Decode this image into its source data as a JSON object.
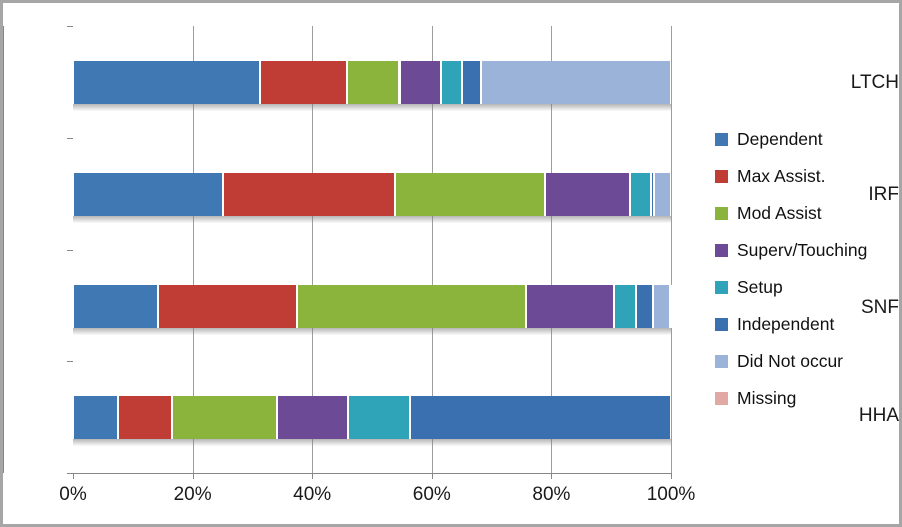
{
  "chart_data": {
    "type": "bar",
    "orientation": "horizontal",
    "stacked": true,
    "stack_mode": "percent",
    "title": "",
    "xlabel": "",
    "ylabel": "",
    "xlim": [
      0,
      100
    ],
    "x_tick_labels": [
      "0%",
      "20%",
      "40%",
      "60%",
      "80%",
      "100%"
    ],
    "x_ticks": [
      0,
      20,
      40,
      60,
      80,
      100
    ],
    "grid": true,
    "grid_axis": "x",
    "legend_position": "right",
    "categories": [
      "LTCH",
      "IRF",
      "SNF",
      "HHA"
    ],
    "series": [
      {
        "name": "Dependent",
        "color": "#4078b4",
        "values": [
          31.3,
          25.1,
          14.2,
          7.6
        ]
      },
      {
        "name": "Max Assist.",
        "color": "#bf3d35",
        "values": [
          14.6,
          28.8,
          23.2,
          8.9
        ]
      },
      {
        "name": "Mod Assist",
        "color": "#8bb43c",
        "values": [
          8.7,
          25.1,
          38.3,
          17.6
        ]
      },
      {
        "name": "Superv/Touching",
        "color": "#6d4a96",
        "values": [
          6.9,
          14.2,
          14.7,
          11.9
        ]
      },
      {
        "name": "Setup",
        "color": "#2fa3b8",
        "values": [
          3.5,
          3.5,
          3.8,
          10.4
        ]
      },
      {
        "name": "Independent",
        "color": "#3a6fb0",
        "values": [
          3.2,
          0.5,
          2.8,
          43.6
        ]
      },
      {
        "name": "Did Not occur",
        "color": "#9cb3d9",
        "values": [
          31.8,
          2.8,
          2.8,
          0.0
        ]
      },
      {
        "name": "Missing",
        "color": "#e0a9a4",
        "values": [
          0.0,
          0.0,
          0.2,
          0.0
        ]
      }
    ]
  },
  "axis": {
    "y_categories": [
      "LTCH",
      "IRF",
      "SNF",
      "HHA"
    ],
    "x_tick_labels": [
      "0%",
      "20%",
      "40%",
      "60%",
      "80%",
      "100%"
    ]
  },
  "legend": {
    "items": [
      {
        "label": "Dependent",
        "color": "#4078b4"
      },
      {
        "label": "Max Assist.",
        "color": "#bf3d35"
      },
      {
        "label": "Mod Assist",
        "color": "#8bb43c"
      },
      {
        "label": "Superv/Touching",
        "color": "#6d4a96"
      },
      {
        "label": "Setup",
        "color": "#2fa3b8"
      },
      {
        "label": "Independent",
        "color": "#3a6fb0"
      },
      {
        "label": "Did Not occur",
        "color": "#9cb3d9"
      },
      {
        "label": "Missing",
        "color": "#e0a9a4"
      }
    ]
  }
}
